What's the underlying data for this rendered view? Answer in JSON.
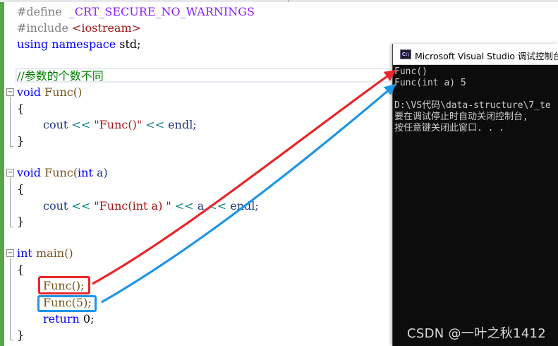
{
  "editor": {
    "lines": {
      "define_kw": "#define",
      "define_macro": "_CRT_SECURE_NO_WARNINGS",
      "include_kw": "#include",
      "include_target": "<iostream>",
      "using_kw": "using",
      "namespace_kw": "namespace",
      "std_tail": " std;",
      "comment": "//参数的个数不同",
      "func1_ret": "void",
      "func1_sig": " Func()",
      "brace_open": "{",
      "brace_close": "}",
      "cout1_a": "cout ",
      "cout1_op1": "<<",
      "cout1_str": " \"Func()\" ",
      "cout1_op2": "<<",
      "cout1_end": " endl;",
      "func2_ret": "void",
      "func2_name": " Func(",
      "func2_int": "int",
      "func2_param": " a)",
      "cout2_a": "cout ",
      "cout2_op1": "<<",
      "cout2_str": " \"Func(int a) \" ",
      "cout2_op2": "<<",
      "cout2_mid": " a ",
      "cout2_op3": "<<",
      "cout2_end": " endl;",
      "main_ret": "int",
      "main_sig": " main()",
      "call1": "Func();",
      "call2": "Func(5);",
      "return_kw": "return",
      "return_val": " 0;"
    }
  },
  "console": {
    "icon_text": "C:\\",
    "title": "Microsoft Visual Studio 调试控制台",
    "output": [
      "Func()",
      "Func(int a) 5",
      "",
      "D:\\VS代码\\data-structure\\7_te",
      "要在调试停止时自动关闭控制台,",
      "按任意键关闭此窗口. . ."
    ]
  },
  "watermark": "CSDN @一叶之秋1412",
  "colors": {
    "highlight_red": "#e8262b",
    "highlight_blue": "#1f95e9",
    "gutter_green": "#57a64a",
    "console_bg": "#0c0c0c"
  }
}
